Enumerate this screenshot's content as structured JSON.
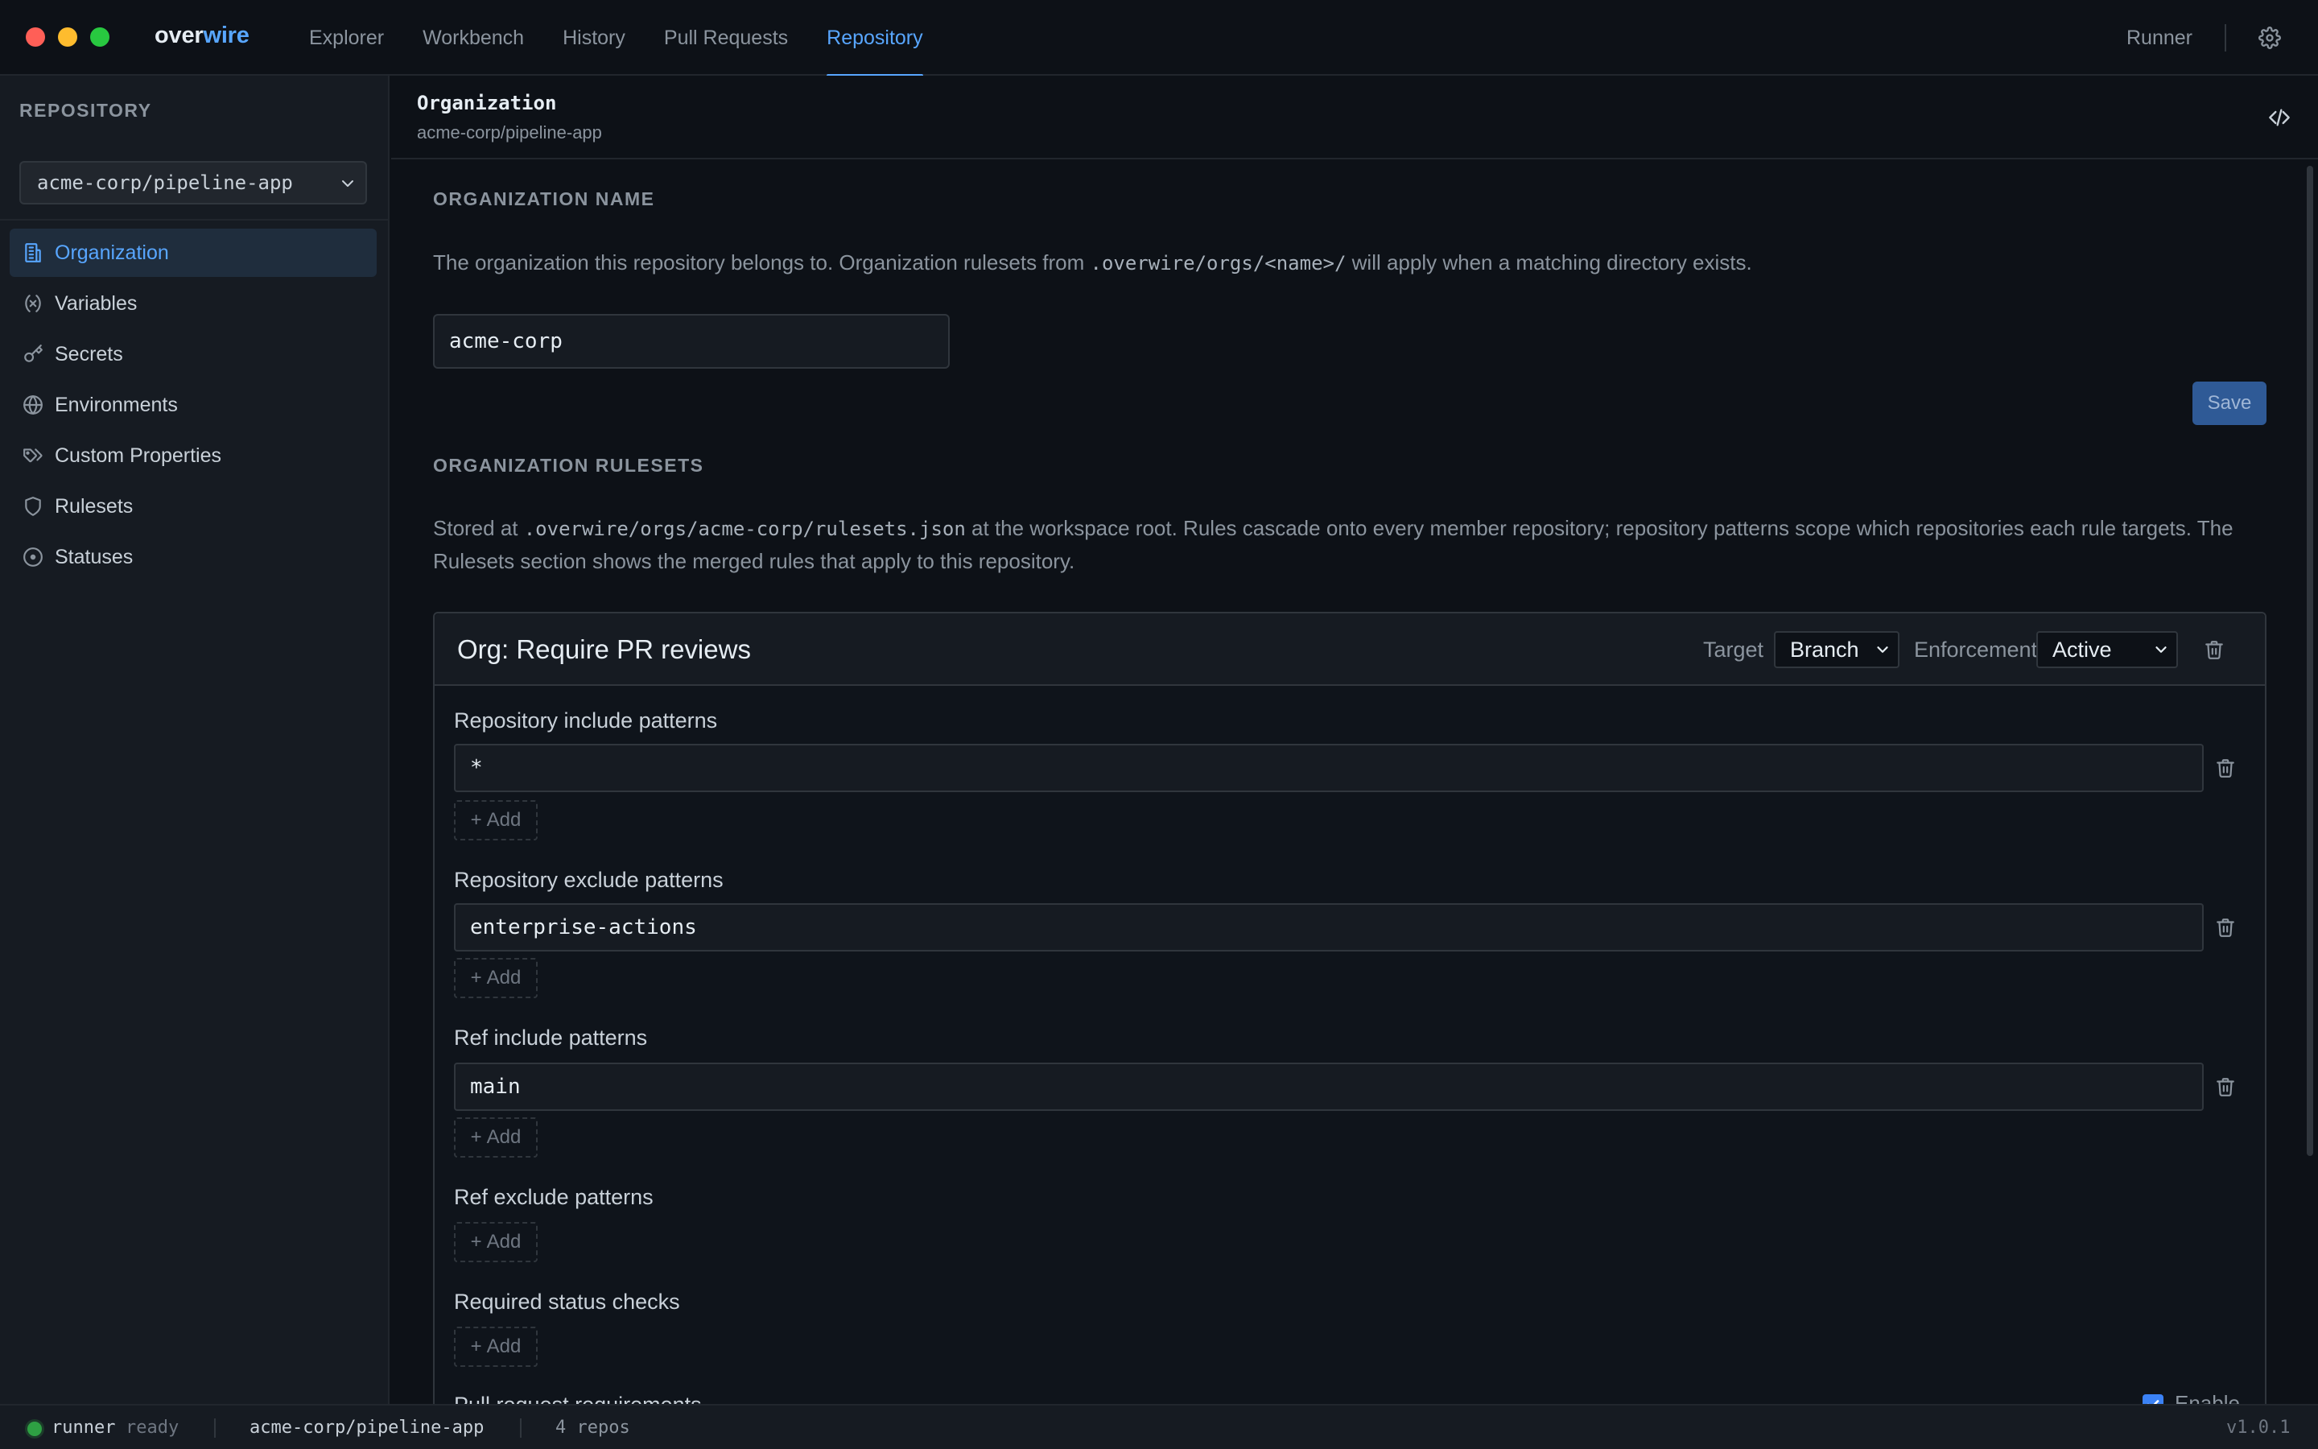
{
  "app": {
    "brand_part1": "over",
    "brand_part2": "wire"
  },
  "nav": [
    {
      "label": "Explorer"
    },
    {
      "label": "Workbench"
    },
    {
      "label": "History"
    },
    {
      "label": "Pull Requests"
    },
    {
      "label": "Repository",
      "active": true
    }
  ],
  "topbar": {
    "runner_label": "Runner"
  },
  "sidebar": {
    "heading": "REPOSITORY",
    "repo_selected": "acme-corp/pipeline-app",
    "items": [
      {
        "label": "Organization",
        "icon": "building-icon",
        "active": true
      },
      {
        "label": "Variables",
        "icon": "variable-icon"
      },
      {
        "label": "Secrets",
        "icon": "key-icon"
      },
      {
        "label": "Environments",
        "icon": "globe-icon"
      },
      {
        "label": "Custom Properties",
        "icon": "tags-icon"
      },
      {
        "label": "Rulesets",
        "icon": "shield-icon"
      },
      {
        "label": "Statuses",
        "icon": "circle-dot-icon"
      }
    ]
  },
  "main": {
    "title": "Organization",
    "subtitle": "acme-corp/pipeline-app",
    "org_name_section": "ORGANIZATION NAME",
    "org_desc_pre": "The organization this repository belongs to. Organization rulesets from ",
    "org_desc_code": ".overwire/orgs/<name>/",
    "org_desc_post": " will apply when a matching directory exists.",
    "org_input_value": "acme-corp",
    "save_label": "Save",
    "rulesets_section": "ORGANIZATION RULESETS",
    "rulesets_desc_pre": "Stored at ",
    "rulesets_desc_code": ".overwire/orgs/acme-corp/rulesets.json",
    "rulesets_desc_post": " at the workspace root. Rules cascade onto every member repository; repository patterns scope which repositories each rule targets. The Rulesets section shows the merged rules that apply to this repository."
  },
  "ruleset": {
    "title": "Org: Require PR reviews",
    "target_label": "Target",
    "target_value": "Branch",
    "enforcement_label": "Enforcement",
    "enforcement_value": "Active",
    "repo_include_label": "Repository include patterns",
    "repo_include_value": "*",
    "repo_exclude_label": "Repository exclude patterns",
    "repo_exclude_value": "enterprise-actions",
    "ref_include_label": "Ref include patterns",
    "ref_include_value": "main",
    "ref_exclude_label": "Ref exclude patterns",
    "status_checks_label": "Required status checks",
    "pr_requirements_label": "Pull request requirements",
    "enable_label": "Enable",
    "add_label": "Add"
  },
  "statusbar": {
    "runner": "runner",
    "runner_state": "ready",
    "repo": "acme-corp/pipeline-app",
    "repo_count": "4 repos",
    "version": "v1.0.1"
  },
  "colors": {
    "accent": "#58a6ff",
    "background": "#0d1117",
    "panel": "#161b22",
    "status_ok": "#2ea043",
    "save_button": "#2f5a96"
  }
}
